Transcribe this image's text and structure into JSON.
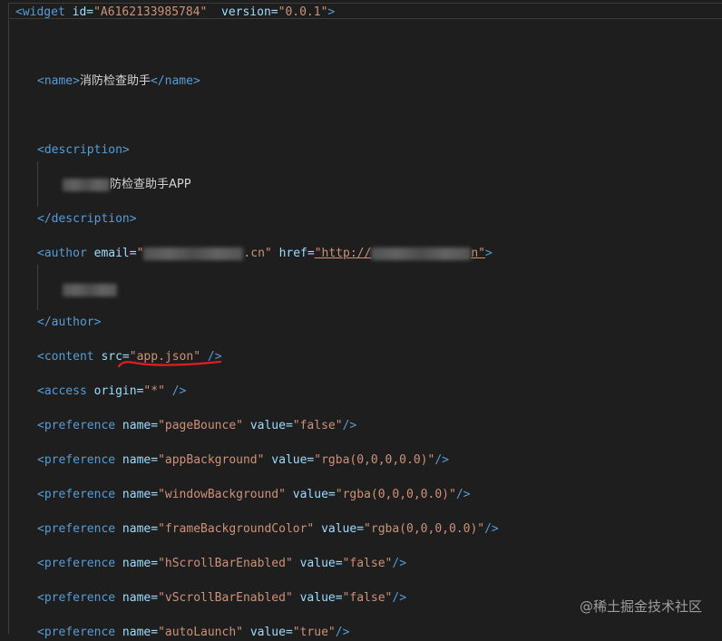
{
  "widget": {
    "open": "<widget",
    "id_attr": "id=",
    "id_val": "\"A6162133985784\"",
    "ver_attr": "version=",
    "ver_val": "\"0.0.1\"",
    "close": ">"
  },
  "name_line": {
    "open": "<name>",
    "text": "消防检查助手",
    "close": "</name>"
  },
  "desc_open": "<description>",
  "desc_text": "防检查助手APP",
  "desc_close": "</description>",
  "author": {
    "open": "<author",
    "email_attr": "email=",
    "email_q": "\"",
    "email_tail": ".cn\"",
    "href_attr": "href=",
    "href_head": "\"http://",
    "href_tail": "n\"",
    "close": ">",
    "end": "</author>"
  },
  "content": {
    "open": "<content",
    "src_attr": "src=",
    "src_val": "\"app.json\"",
    "close": " />"
  },
  "access": {
    "open": "<access",
    "origin_attr": "origin=",
    "origin_val": "\"*\"",
    "close": " />"
  },
  "preferences": [
    {
      "name": "\"pageBounce\"",
      "value": "\"false\""
    },
    {
      "name": "\"appBackground\"",
      "value": "\"rgba(0,0,0,0.0)\""
    },
    {
      "name": "\"windowBackground\"",
      "value": "\"rgba(0,0,0,0.0)\""
    },
    {
      "name": "\"frameBackgroundColor\"",
      "value": "\"rgba(0,0,0,0.0)\""
    },
    {
      "name": "\"hScrollBarEnabled\"",
      "value": "\"false\""
    },
    {
      "name": "\"vScrollBarEnabled\"",
      "value": "\"false\""
    },
    {
      "name": "\"autoLaunch\"",
      "value": "\"true\""
    }
  ],
  "pref": {
    "open": "<preference",
    "name_attr": "name=",
    "value_attr": "value=",
    "close": "/>"
  },
  "watermark": "@稀土掘金技术社区",
  "colors": {
    "tag": "#569cd6",
    "attr": "#9cdcfe",
    "string": "#ce9178",
    "text": "#d4d4d4",
    "background": "#1e1e1e",
    "underline": "#e01e1e"
  }
}
